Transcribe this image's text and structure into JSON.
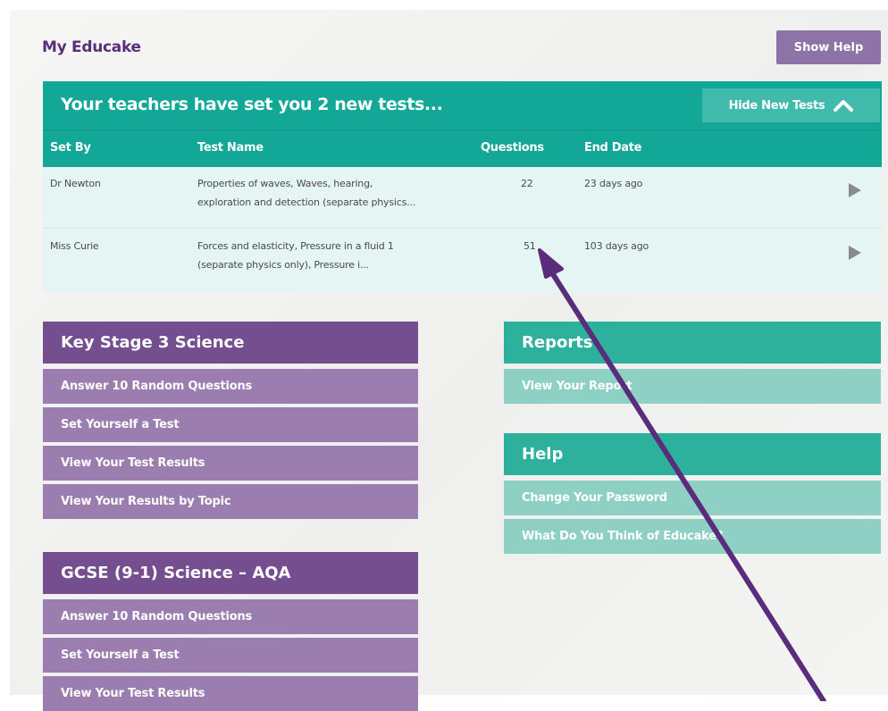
{
  "header": {
    "title": "My Educake",
    "show_help_label": "Show Help"
  },
  "new_tests": {
    "title": "Your teachers have set you 2 new tests...",
    "hide_label": "Hide New Tests",
    "columns": [
      "Set By",
      "Test Name",
      "Questions",
      "End Date"
    ],
    "rows": [
      {
        "set_by": "Dr Newton",
        "test_name_line1": "Properties of waves, Waves, hearing,",
        "test_name_line2": "exploration and detection (separate physics...",
        "questions": "22",
        "end_date": "23 days ago"
      },
      {
        "set_by": "Miss Curie",
        "test_name_line1": "Forces and elasticity, Pressure in a fluid 1",
        "test_name_line2": "(separate physics only), Pressure i...",
        "questions": "51",
        "end_date": "103 days ago"
      }
    ]
  },
  "ks3": {
    "title": "Key Stage 3 Science",
    "items": [
      "Answer 10 Random Questions",
      "Set Yourself a Test",
      "View Your Test Results",
      "View Your Results by Topic"
    ]
  },
  "gcse": {
    "title": "GCSE (9-1) Science – AQA",
    "items": [
      "Answer 10 Random Questions",
      "Set Yourself a Test",
      "View Your Test Results"
    ]
  },
  "reports": {
    "title": "Reports",
    "items": [
      "View Your Report"
    ]
  },
  "help": {
    "title": "Help",
    "items": [
      "Change Your Password",
      "What Do You Think of Educake?"
    ]
  },
  "icons": {
    "hide": "chevron-up-icon",
    "row_action": "play-icon",
    "annotation": "arrow-annotation"
  },
  "colors": {
    "brand_purple": "#744e8e",
    "brand_teal": "#12a796"
  }
}
